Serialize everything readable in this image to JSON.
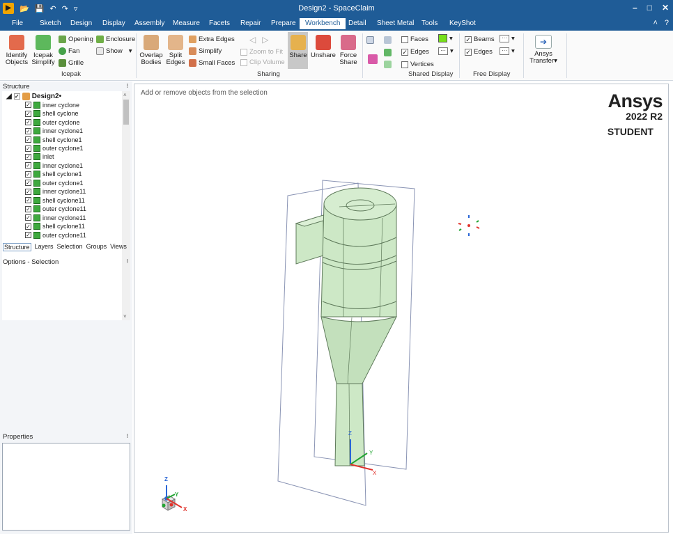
{
  "window": {
    "title": "Design2 - SpaceClaim"
  },
  "menu": {
    "items": [
      "File",
      "Sketch",
      "Design",
      "Display",
      "Assembly",
      "Measure",
      "Facets",
      "Repair",
      "Prepare",
      "Workbench",
      "Detail",
      "Sheet Metal",
      "Tools",
      "KeyShot"
    ],
    "active": "Workbench"
  },
  "ribbon": {
    "identify_objects": "Identify Objects",
    "icepak_simplify": "Icepak Simplify",
    "opening": "Opening",
    "fan": "Fan",
    "grille": "Grille",
    "enclosure": "Enclosure",
    "show": "Show",
    "icepak_group": "Icepak",
    "overlap_bodies": "Overlap Bodies",
    "split_edges": "Split Edges",
    "extra_edges": "Extra Edges",
    "simplify": "Simplify",
    "small_faces": "Small Faces",
    "zoom_to_fit": "Zoom to Fit",
    "clip_volume": "Clip Volume",
    "sharing_group": "Sharing",
    "share": "Share",
    "unshare": "Unshare",
    "force_share": "Force Share",
    "faces": "Faces",
    "edges": "Edges",
    "vertices": "Vertices",
    "shared_display_group": "Shared Display",
    "beams": "Beams",
    "free_edges": "Edges",
    "free_display_group": "Free Display",
    "ansys_transfer": "Ansys Transfer"
  },
  "structure": {
    "title": "Structure",
    "root": "Design2•",
    "items": [
      "inner cyclone",
      "shell cyclone",
      "outer cyclone",
      "inner cyclone1",
      "shell cyclone1",
      "outer cyclone1",
      "inlet",
      "inner cyclone1",
      "shell cyclone1",
      "outer cyclone1",
      "inner cyclone11",
      "shell cyclone11",
      "outer cyclone11",
      "inner cyclone11",
      "shell cyclone11",
      "outer cyclone11"
    ],
    "tabs": [
      "Structure",
      "Layers",
      "Selection",
      "Groups",
      "Views"
    ]
  },
  "options": {
    "title": "Options - Selection"
  },
  "properties": {
    "title": "Properties"
  },
  "viewport": {
    "hint": "Add or remove objects from the selection",
    "brand_name": "Ansys",
    "brand_version": "2022 R2",
    "brand_edition": "STUDENT",
    "axis_x": "X",
    "axis_y": "Y",
    "axis_z": "Z"
  },
  "colors": {
    "accent": "#1f5c97",
    "body": "#cde8c6",
    "body_edge": "#5f7a5b",
    "face_swatch": "#77e01a"
  }
}
